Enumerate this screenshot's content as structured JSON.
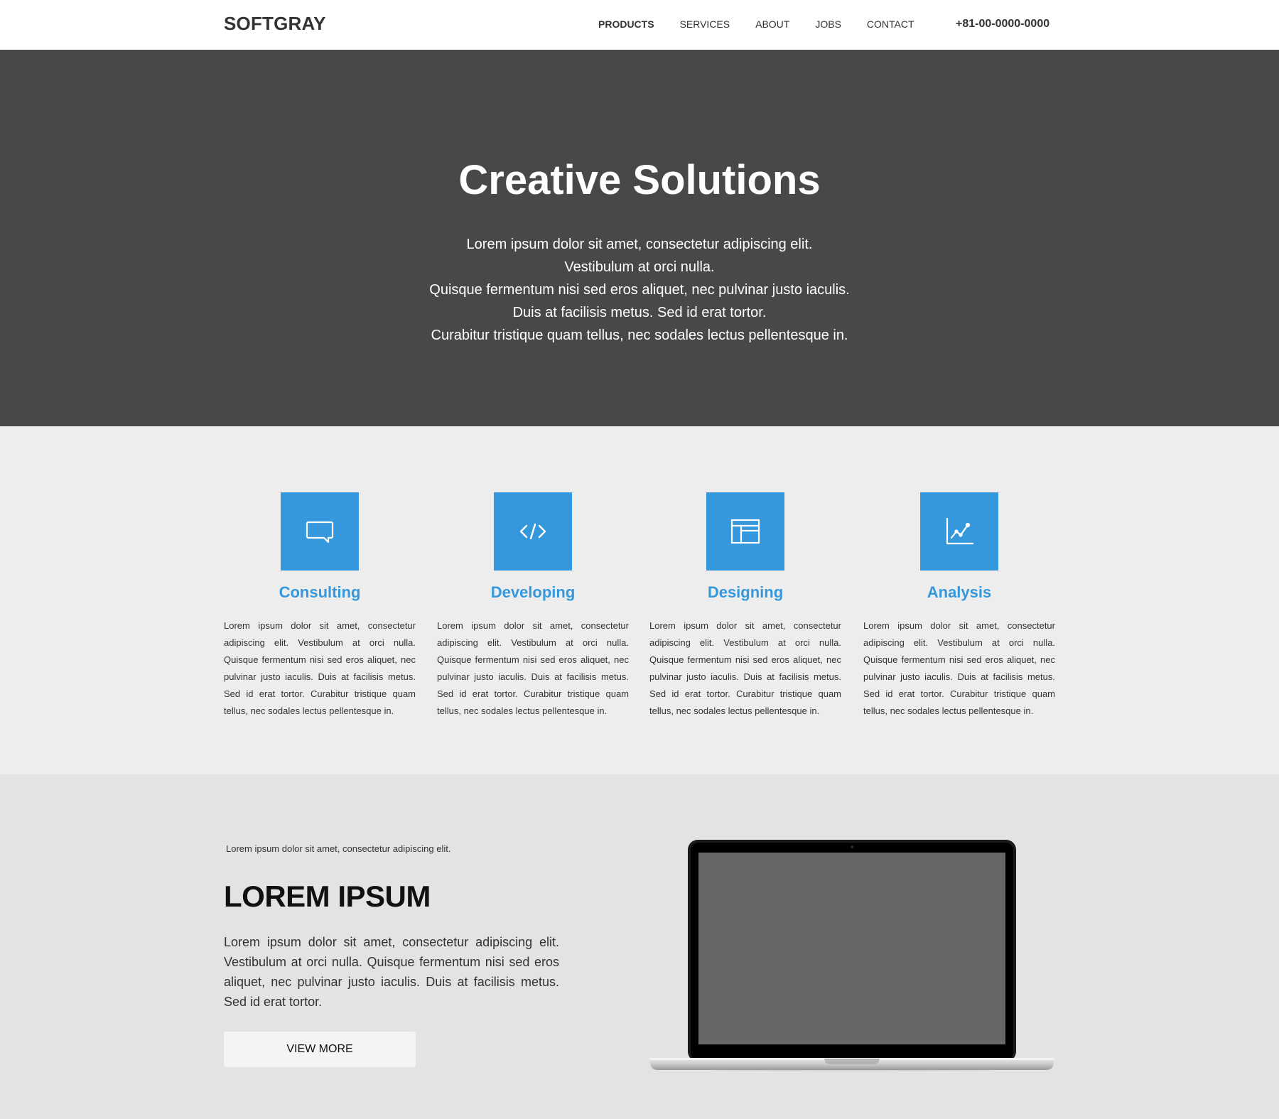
{
  "header": {
    "logo": "SOFTGRAY",
    "nav": [
      "PRODUCTS",
      "SERVICES",
      "ABOUT",
      "JOBS",
      "CONTACT"
    ],
    "active_nav": "PRODUCTS",
    "phone": "+81-00-0000-0000"
  },
  "hero": {
    "title": "Creative Solutions",
    "lines": [
      "Lorem ipsum dolor sit amet, consectetur adipiscing elit.",
      "Vestibulum at orci nulla.",
      "Quisque fermentum nisi sed eros aliquet, nec pulvinar justo iaculis.",
      "Duis at facilisis metus. Sed id erat tortor.",
      "Curabitur tristique quam tellus, nec sodales lectus pellentesque in."
    ]
  },
  "features": [
    {
      "title": "Consulting",
      "icon": "chat-bubble-icon",
      "text": "Lorem ipsum dolor sit amet, consectetur adipiscing elit. Vestibulum at orci nulla. Quisque fermentum nisi sed eros aliquet, nec pulvinar justo iaculis. Duis at facilisis metus. Sed id erat tortor. Curabitur tristique quam tellus, nec sodales lectus pellentesque in."
    },
    {
      "title": "Developing",
      "icon": "code-icon",
      "text": "Lorem ipsum dolor sit amet, consectetur adipiscing elit. Vestibulum at orci nulla. Quisque fermentum nisi sed eros aliquet, nec pulvinar justo iaculis. Duis at facilisis metus. Sed id erat tortor. Curabitur tristique quam tellus, nec sodales lectus pellentesque in."
    },
    {
      "title": "Designing",
      "icon": "layout-icon",
      "text": "Lorem ipsum dolor sit amet, consectetur adipiscing elit. Vestibulum at orci nulla. Quisque fermentum nisi sed eros aliquet, nec pulvinar justo iaculis. Duis at facilisis metus. Sed id erat tortor. Curabitur tristique quam tellus, nec sodales lectus pellentesque in."
    },
    {
      "title": "Analysis",
      "icon": "chart-icon",
      "text": "Lorem ipsum dolor sit amet, consectetur adipiscing elit. Vestibulum at orci nulla. Quisque fermentum nisi sed eros aliquet, nec pulvinar justo iaculis. Duis at facilisis metus. Sed id erat tortor. Curabitur tristique quam tellus, nec sodales lectus pellentesque in."
    }
  ],
  "promo": {
    "kicker": "Lorem ipsum dolor sit amet, consectetur adipiscing elit.",
    "title": "LOREM IPSUM",
    "text": "Lorem ipsum dolor sit amet, consectetur adipiscing elit. Vestibulum at orci nulla. Quisque fermentum nisi sed eros aliquet, nec pulvinar justo iaculis. Duis at facilisis metus. Sed id erat tortor.",
    "button": "VIEW MORE"
  },
  "colors": {
    "accent": "#3598dc",
    "hero_bg": "#484848",
    "features_bg": "#ededed",
    "promo_bg": "#e3e3e3"
  }
}
